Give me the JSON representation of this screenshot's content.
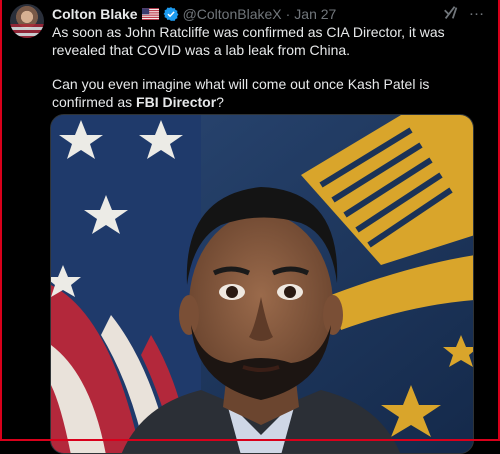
{
  "tweet": {
    "author_name": "Colton Blake",
    "handle": "@ColtonBlakeX",
    "separator": "·",
    "date": "Jan 27",
    "more": "…",
    "paragraph1": "As soon as John Ratcliffe was confirmed as CIA Director, it was revealed that COVID was a lab leak from China.",
    "paragraph2_prefix": "Can you even imagine what will come out once Kash Patel is confirmed as ",
    "paragraph2_bold": "FBI Director",
    "paragraph2_suffix": "?"
  },
  "icons": {
    "flag": "us-flag-icon",
    "verified": "verified-badge-icon",
    "grok": "grok-icon",
    "more": "more-icon"
  },
  "colors": {
    "background": "#000000",
    "text": "#e7e9ea",
    "muted": "#71767b",
    "verified": "#1d9bf0",
    "frame_border": "#d9001b"
  }
}
